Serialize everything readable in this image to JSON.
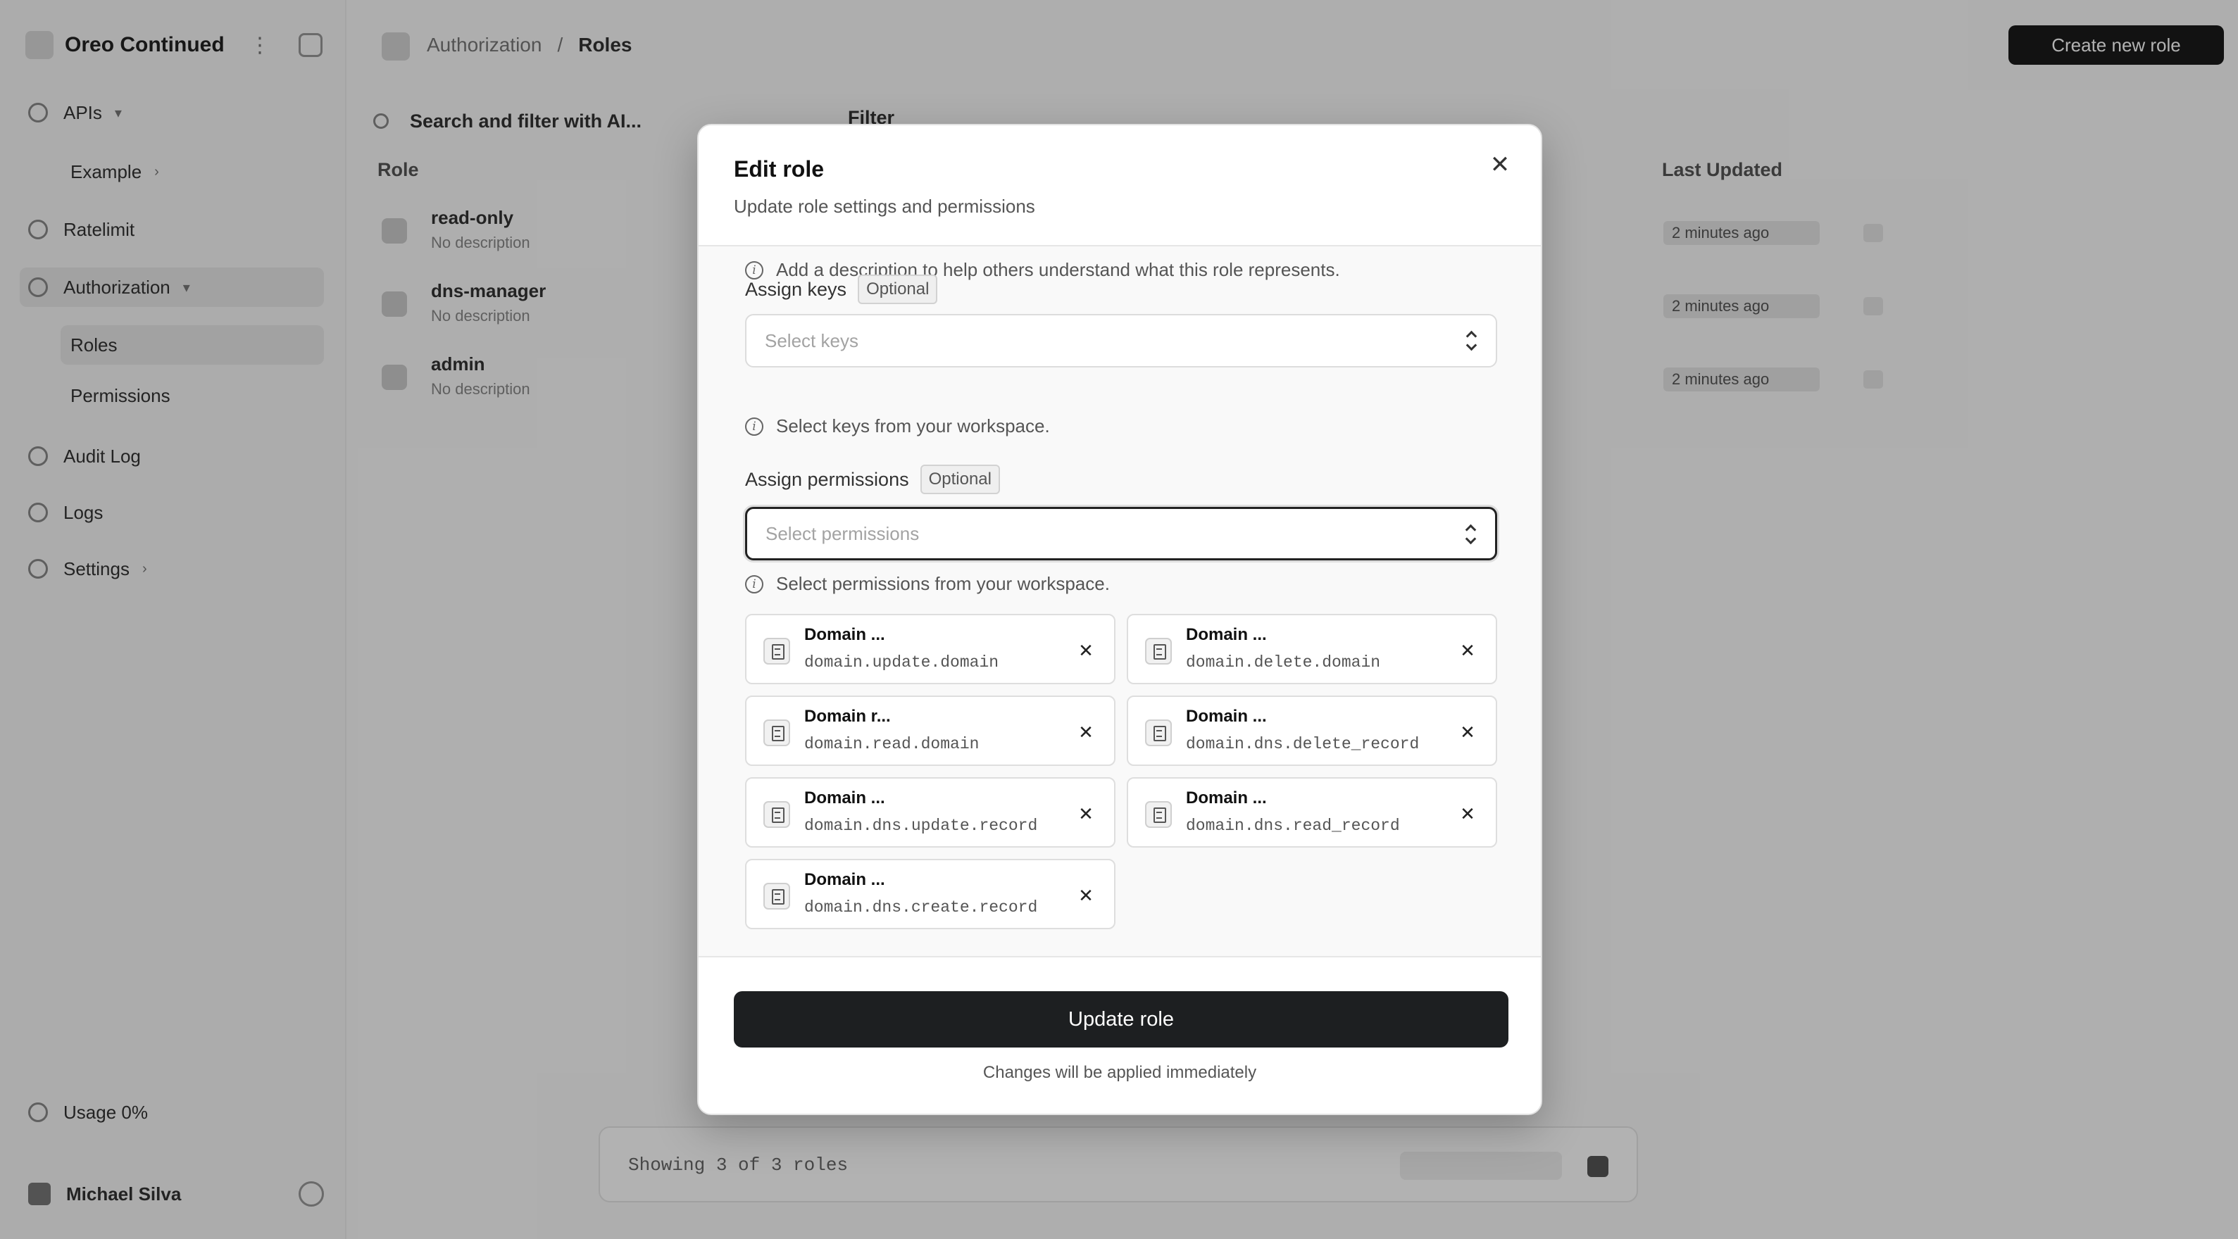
{
  "app": {
    "workspace_name": "Oreo Continued",
    "user_name": "Michael Silva",
    "usage_label": "Usage 0%"
  },
  "sidebar": {
    "items": [
      {
        "label": "APIs",
        "icon": "nodes-icon"
      },
      {
        "label": "Example",
        "icon": ""
      },
      {
        "label": "Ratelimit",
        "icon": "gauge-icon"
      },
      {
        "label": "Authorization",
        "icon": "shield-icon"
      },
      {
        "label": "Roles",
        "icon": ""
      },
      {
        "label": "Permissions",
        "icon": ""
      },
      {
        "label": "Audit Log",
        "icon": "list-icon"
      },
      {
        "label": "Logs",
        "icon": "layers-icon"
      },
      {
        "label": "Settings",
        "icon": "gear-icon"
      }
    ]
  },
  "header": {
    "breadcrumb_parent": "Authorization",
    "breadcrumb_sep": "/",
    "breadcrumb_current": "Roles",
    "create_button": "Create new role"
  },
  "toolbar": {
    "search_placeholder": "Search and filter with AI...",
    "filter_label": "Filter"
  },
  "table": {
    "col_role": "Role",
    "col_updated": "Last Updated",
    "rows": [
      {
        "name": "read-only",
        "desc": "No description",
        "updated": "2 minutes ago"
      },
      {
        "name": "dns-manager",
        "desc": "No description",
        "updated": "2 minutes ago"
      },
      {
        "name": "admin",
        "desc": "No description",
        "updated": "2 minutes ago"
      }
    ],
    "pager_text": "Showing 3 of 3 roles"
  },
  "modal": {
    "title": "Edit role",
    "subtitle": "Update role settings and permissions",
    "description_hint": "Add a description to help others understand what this role represents.",
    "keys_label": "Assign keys",
    "keys_badge": "Optional",
    "keys_placeholder": "Select keys",
    "keys_hint": "Select keys from your workspace.",
    "perms_label": "Assign permissions",
    "perms_badge": "Optional",
    "perms_placeholder": "Select permissions",
    "perms_hint": "Select permissions from your workspace.",
    "permissions": [
      {
        "name": "Domain ...",
        "slug": "domain.update.domain"
      },
      {
        "name": "Domain ...",
        "slug": "domain.delete.domain"
      },
      {
        "name": "Domain r...",
        "slug": "domain.read.domain"
      },
      {
        "name": "Domain ...",
        "slug": "domain.dns.delete_record"
      },
      {
        "name": "Domain ...",
        "slug": "domain.dns.update.record"
      },
      {
        "name": "Domain ...",
        "slug": "domain.dns.read_record"
      },
      {
        "name": "Domain ...",
        "slug": "domain.dns.create.record"
      }
    ],
    "submit_label": "Update role",
    "footer_note": "Changes will be applied immediately"
  }
}
